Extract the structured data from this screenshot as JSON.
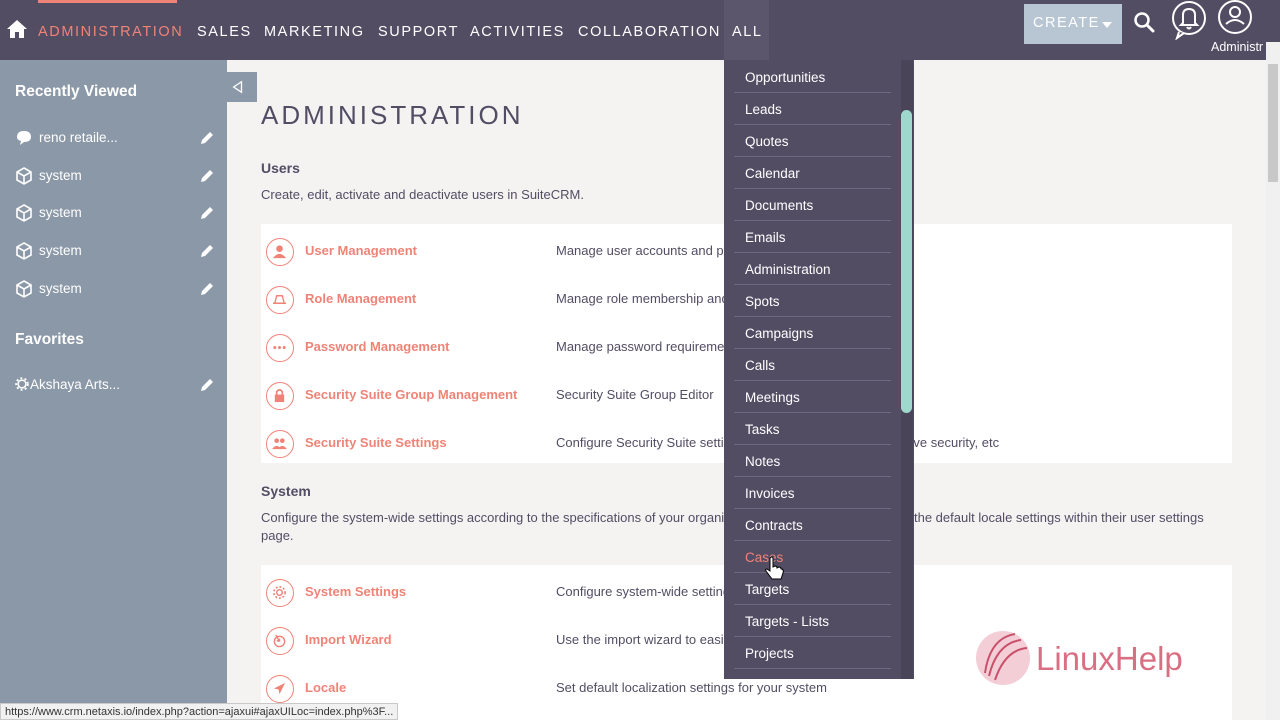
{
  "colors": {
    "accent": "#f08377",
    "nav_bg": "#534d64",
    "sidebar_bg": "#8b98a7",
    "dropdown_scroll": "#9fd8cc"
  },
  "nav": {
    "tabs": [
      "ADMINISTRATION",
      "SALES",
      "MARKETING",
      "SUPPORT",
      "ACTIVITIES",
      "COLLABORATION",
      "ALL"
    ],
    "active_tab": "ADMINISTRATION",
    "create_label": "CREATE",
    "user_label": "Administr"
  },
  "sidebar": {
    "recent_title": "Recently Viewed",
    "recent_items": [
      {
        "label": "reno retaile...",
        "icon": "chat-bubble-icon"
      },
      {
        "label": "system",
        "icon": "cube-icon"
      },
      {
        "label": "system",
        "icon": "cube-icon"
      },
      {
        "label": "system",
        "icon": "cube-icon"
      },
      {
        "label": "system",
        "icon": "cube-icon"
      }
    ],
    "favorites_title": "Favorites",
    "favorite_items": [
      {
        "label": "Akshaya Arts...",
        "icon": "gear-icon"
      }
    ]
  },
  "main": {
    "title": "ADMINISTRATION",
    "users": {
      "heading": "Users",
      "description": "Create, edit, activate and deactivate users in SuiteCRM.",
      "rows": [
        {
          "link": "User Management",
          "desc": "Manage user accounts and pas",
          "icon": "user-icon"
        },
        {
          "link": "Role Management",
          "desc": "Manage role membership and",
          "icon": "role-icon"
        },
        {
          "link": "Password Management",
          "desc": "Manage password requiremen",
          "icon": "password-dots-icon"
        },
        {
          "link": "Security Suite Group Management",
          "desc": "Security Suite Group Editor",
          "icon": "lock-icon"
        },
        {
          "link": "Security Suite Settings",
          "desc": "Configure Security Suite setti",
          "icon": "group-icon"
        }
      ],
      "row5_tail": "itive security, etc"
    },
    "system": {
      "heading": "System",
      "description_left": "Configure the system-wide settings according to the specifications of your organiz",
      "description_right": "the default locale settings within their user settings",
      "description_line2": "page.",
      "rows": [
        {
          "link": "System Settings",
          "desc": "Configure system-wide setting",
          "icon": "settings-icon"
        },
        {
          "link": "Import Wizard",
          "desc": "Use the import wizard to easil",
          "icon": "import-icon"
        },
        {
          "link": "Locale",
          "desc": "Set default localization settings for your system",
          "icon": "locale-icon"
        }
      ]
    }
  },
  "dropdown": {
    "items": [
      "Opportunities",
      "Leads",
      "Quotes",
      "Calendar",
      "Documents",
      "Emails",
      "Administration",
      "Spots",
      "Campaigns",
      "Calls",
      "Meetings",
      "Tasks",
      "Notes",
      "Invoices",
      "Contracts",
      "Cases",
      "Targets",
      "Targets - Lists",
      "Projects"
    ],
    "hovered": "Cases"
  },
  "status_url": "https://www.crm.netaxis.io/index.php?action=ajaxui#ajaxUILoc=index.php%3F...",
  "watermark": "LinuxHelp"
}
